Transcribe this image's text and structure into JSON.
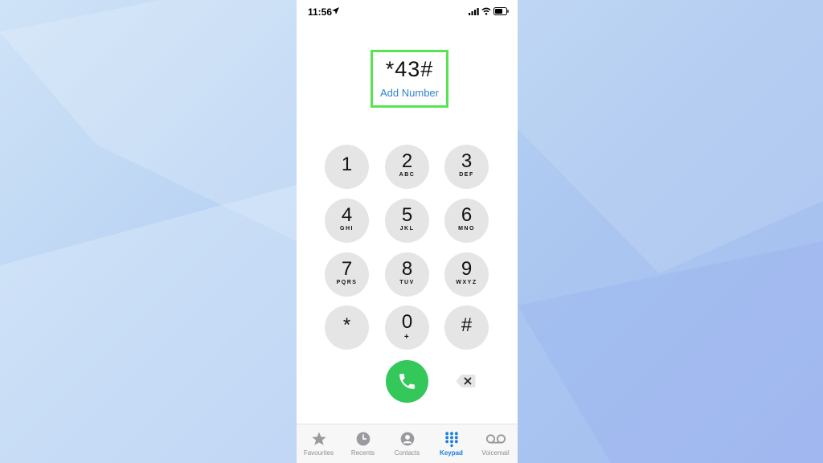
{
  "status_bar": {
    "time": "11:56"
  },
  "dialer": {
    "number": "*43#",
    "add_number_label": "Add Number"
  },
  "keypad": {
    "keys": [
      {
        "digit": "1",
        "letters": ""
      },
      {
        "digit": "2",
        "letters": "ABC"
      },
      {
        "digit": "3",
        "letters": "DEF"
      },
      {
        "digit": "4",
        "letters": "GHI"
      },
      {
        "digit": "5",
        "letters": "JKL"
      },
      {
        "digit": "6",
        "letters": "MNO"
      },
      {
        "digit": "7",
        "letters": "PQRS"
      },
      {
        "digit": "8",
        "letters": "TUV"
      },
      {
        "digit": "9",
        "letters": "WXYZ"
      },
      {
        "digit": "*",
        "letters": ""
      },
      {
        "digit": "0",
        "letters": "+"
      },
      {
        "digit": "#",
        "letters": ""
      }
    ]
  },
  "tabs": [
    {
      "label": "Favourites",
      "icon": "star-icon",
      "active": false
    },
    {
      "label": "Recents",
      "icon": "clock-icon",
      "active": false
    },
    {
      "label": "Contacts",
      "icon": "person-icon",
      "active": false
    },
    {
      "label": "Keypad",
      "icon": "keypad-icon",
      "active": true
    },
    {
      "label": "Voicemail",
      "icon": "voicemail-icon",
      "active": false
    }
  ],
  "colors": {
    "highlight_box": "#55e64f",
    "call_button": "#34c759",
    "accent": "#1a7fe0",
    "key_background": "#e5e5e5"
  }
}
